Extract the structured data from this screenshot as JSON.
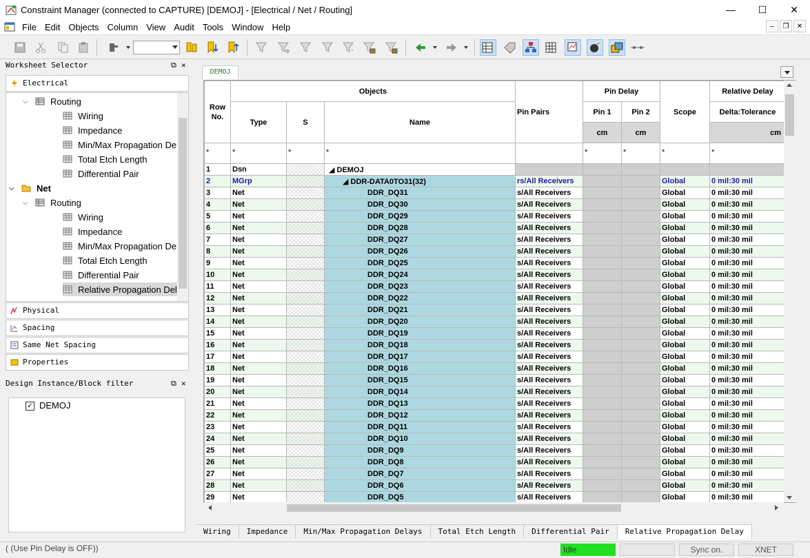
{
  "window": {
    "title": "Constraint Manager (connected to CAPTURE) [DEMOJ] - [Electrical / Net / Routing]",
    "minimize": "—",
    "maximize": "☐",
    "close": "✕"
  },
  "menu": [
    "File",
    "Edit",
    "Objects",
    "Column",
    "View",
    "Audit",
    "Tools",
    "Window",
    "Help"
  ],
  "worksheet_selector": {
    "title": "Worksheet Selector",
    "electrical_label": "Electrical",
    "tree": [
      {
        "label": "Routing",
        "indent": 1,
        "expander": "⌄"
      },
      {
        "label": "Wiring",
        "indent": 2
      },
      {
        "label": "Impedance",
        "indent": 2
      },
      {
        "label": "Min/Max Propagation De...",
        "indent": 2
      },
      {
        "label": "Total Etch Length",
        "indent": 2
      },
      {
        "label": "Differential Pair",
        "indent": 2
      },
      {
        "label": "Net",
        "indent": 0,
        "expander": "⌄",
        "bold": true
      },
      {
        "label": "Routing",
        "indent": 1,
        "expander": "⌄"
      },
      {
        "label": "Wiring",
        "indent": 2
      },
      {
        "label": "Impedance",
        "indent": 2
      },
      {
        "label": "Min/Max Propagation De...",
        "indent": 2
      },
      {
        "label": "Total Etch Length",
        "indent": 2
      },
      {
        "label": "Differential Pair",
        "indent": 2
      },
      {
        "label": "Relative Propagation Delay",
        "indent": 2,
        "selected": true
      }
    ],
    "sections": [
      "Physical",
      "Spacing",
      "Same Net Spacing",
      "Properties"
    ]
  },
  "design_filter": {
    "title": "Design Instance/Block filter",
    "item": "DEMOJ"
  },
  "doc_tab": "DEMOJ",
  "grid": {
    "headers": {
      "row_no": "Row No.",
      "objects": "Objects",
      "type": "Type",
      "s": "S",
      "name": "Name",
      "pin_pairs": "Pin Pairs",
      "pin_delay": "Pin Delay",
      "pin1": "Pin 1",
      "pin2": "Pin 2",
      "scope": "Scope",
      "relative_delay": "Relative Delay",
      "delta_tol": "Delta:Tolerance",
      "unit_cm": "cm",
      "filter": "*"
    },
    "rows": [
      {
        "no": "1",
        "type": "Dsn",
        "name": "◢ DEMOJ",
        "pp": "",
        "scope": "",
        "rd": "",
        "kind": "dsn"
      },
      {
        "no": "2",
        "type": "MGrp",
        "name": "◢ DDR-DATA0TO31(32)",
        "pp": "rs/All Receivers",
        "scope": "Global",
        "rd": "0 mil:30 mil",
        "kind": "mgrp"
      },
      {
        "no": "3",
        "type": "Net",
        "name": "DDR_DQ31",
        "pp": "s/All Receivers",
        "scope": "Global",
        "rd": "0 mil:30 mil"
      },
      {
        "no": "4",
        "type": "Net",
        "name": "DDR_DQ30",
        "pp": "s/All Receivers",
        "scope": "Global",
        "rd": "0 mil:30 mil"
      },
      {
        "no": "5",
        "type": "Net",
        "name": "DDR_DQ29",
        "pp": "s/All Receivers",
        "scope": "Global",
        "rd": "0 mil:30 mil"
      },
      {
        "no": "6",
        "type": "Net",
        "name": "DDR_DQ28",
        "pp": "s/All Receivers",
        "scope": "Global",
        "rd": "0 mil:30 mil"
      },
      {
        "no": "7",
        "type": "Net",
        "name": "DDR_DQ27",
        "pp": "s/All Receivers",
        "scope": "Global",
        "rd": "0 mil:30 mil"
      },
      {
        "no": "8",
        "type": "Net",
        "name": "DDR_DQ26",
        "pp": "s/All Receivers",
        "scope": "Global",
        "rd": "0 mil:30 mil"
      },
      {
        "no": "9",
        "type": "Net",
        "name": "DDR_DQ25",
        "pp": "s/All Receivers",
        "scope": "Global",
        "rd": "0 mil:30 mil"
      },
      {
        "no": "10",
        "type": "Net",
        "name": "DDR_DQ24",
        "pp": "s/All Receivers",
        "scope": "Global",
        "rd": "0 mil:30 mil"
      },
      {
        "no": "11",
        "type": "Net",
        "name": "DDR_DQ23",
        "pp": "s/All Receivers",
        "scope": "Global",
        "rd": "0 mil:30 mil"
      },
      {
        "no": "12",
        "type": "Net",
        "name": "DDR_DQ22",
        "pp": "s/All Receivers",
        "scope": "Global",
        "rd": "0 mil:30 mil"
      },
      {
        "no": "13",
        "type": "Net",
        "name": "DDR_DQ21",
        "pp": "s/All Receivers",
        "scope": "Global",
        "rd": "0 mil:30 mil"
      },
      {
        "no": "14",
        "type": "Net",
        "name": "DDR_DQ20",
        "pp": "s/All Receivers",
        "scope": "Global",
        "rd": "0 mil:30 mil"
      },
      {
        "no": "15",
        "type": "Net",
        "name": "DDR_DQ19",
        "pp": "s/All Receivers",
        "scope": "Global",
        "rd": "0 mil:30 mil"
      },
      {
        "no": "16",
        "type": "Net",
        "name": "DDR_DQ18",
        "pp": "s/All Receivers",
        "scope": "Global",
        "rd": "0 mil:30 mil"
      },
      {
        "no": "17",
        "type": "Net",
        "name": "DDR_DQ17",
        "pp": "s/All Receivers",
        "scope": "Global",
        "rd": "0 mil:30 mil"
      },
      {
        "no": "18",
        "type": "Net",
        "name": "DDR_DQ16",
        "pp": "s/All Receivers",
        "scope": "Global",
        "rd": "0 mil:30 mil"
      },
      {
        "no": "19",
        "type": "Net",
        "name": "DDR_DQ15",
        "pp": "s/All Receivers",
        "scope": "Global",
        "rd": "0 mil:30 mil"
      },
      {
        "no": "20",
        "type": "Net",
        "name": "DDR_DQ14",
        "pp": "s/All Receivers",
        "scope": "Global",
        "rd": "0 mil:30 mil"
      },
      {
        "no": "21",
        "type": "Net",
        "name": "DDR_DQ13",
        "pp": "s/All Receivers",
        "scope": "Global",
        "rd": "0 mil:30 mil"
      },
      {
        "no": "22",
        "type": "Net",
        "name": "DDR_DQ12",
        "pp": "s/All Receivers",
        "scope": "Global",
        "rd": "0 mil:30 mil"
      },
      {
        "no": "23",
        "type": "Net",
        "name": "DDR_DQ11",
        "pp": "s/All Receivers",
        "scope": "Global",
        "rd": "0 mil:30 mil"
      },
      {
        "no": "24",
        "type": "Net",
        "name": "DDR_DQ10",
        "pp": "s/All Receivers",
        "scope": "Global",
        "rd": "0 mil:30 mil"
      },
      {
        "no": "25",
        "type": "Net",
        "name": "DDR_DQ9",
        "pp": "s/All Receivers",
        "scope": "Global",
        "rd": "0 mil:30 mil"
      },
      {
        "no": "26",
        "type": "Net",
        "name": "DDR_DQ8",
        "pp": "s/All Receivers",
        "scope": "Global",
        "rd": "0 mil:30 mil"
      },
      {
        "no": "27",
        "type": "Net",
        "name": "DDR_DQ7",
        "pp": "s/All Receivers",
        "scope": "Global",
        "rd": "0 mil:30 mil"
      },
      {
        "no": "28",
        "type": "Net",
        "name": "DDR_DQ6",
        "pp": "s/All Receivers",
        "scope": "Global",
        "rd": "0 mil:30 mil"
      },
      {
        "no": "29",
        "type": "Net",
        "name": "DDR_DQ5",
        "pp": "s/All Receivers",
        "scope": "Global",
        "rd": "0 mil:30 mil"
      }
    ]
  },
  "bottom_tabs": [
    "Wiring",
    "Impedance",
    "Min/Max Propagation Delays",
    "Total Etch Length",
    "Differential Pair",
    "Relative Propagation Delay"
  ],
  "status": {
    "message": "( (Use Pin Delay is OFF))",
    "state": "Idle",
    "sync": "Sync on.",
    "mode": "XNET"
  },
  "colors": {
    "name_cell": "#add8e1",
    "odd_row": "#eef9ee",
    "idle": "#22e022",
    "mgrp_text": "#1a1aa6"
  }
}
